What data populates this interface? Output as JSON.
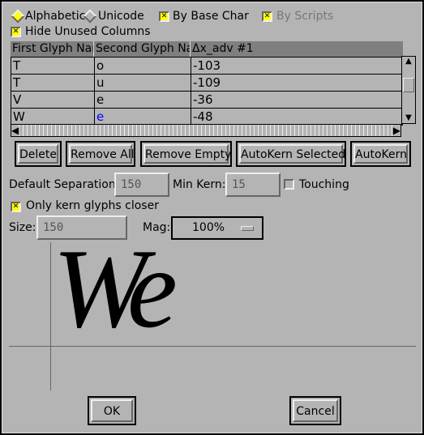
{
  "options": {
    "alphabetic": "Alphabetic",
    "unicode": "Unicode",
    "by_base_char": "By Base Char",
    "by_scripts": "By Scripts",
    "hide_unused": "Hide Unused Columns"
  },
  "table": {
    "columns": [
      "First Glyph Name",
      "Second Glyph Name",
      "Δx_adv #1"
    ],
    "rows": [
      [
        "T",
        "o",
        "-103"
      ],
      [
        "T",
        "u",
        "-109"
      ],
      [
        "V",
        "e",
        "-36"
      ],
      [
        "W",
        "e",
        "-48"
      ]
    ]
  },
  "buttons": {
    "delete": "Delete",
    "remove_all": "Remove All",
    "remove_empty": "Remove Empty",
    "autokern_selected": "AutoKern Selected",
    "autokern": "AutoKern",
    "ok": "OK",
    "cancel": "Cancel"
  },
  "settings": {
    "default_sep_label": "Default Separation:",
    "default_sep": "150",
    "min_kern_label": "Min Kern:",
    "min_kern": "15",
    "touching": "Touching",
    "only_closer": "Only kern glyphs closer",
    "size_label": "Size:",
    "size": "150",
    "mag_label": "Mag:",
    "mag": "100%"
  },
  "preview": {
    "text": "We"
  },
  "colors": {
    "background": "#b4b4b4",
    "checkbox": "#ffff00",
    "editing": "#0000ff"
  }
}
